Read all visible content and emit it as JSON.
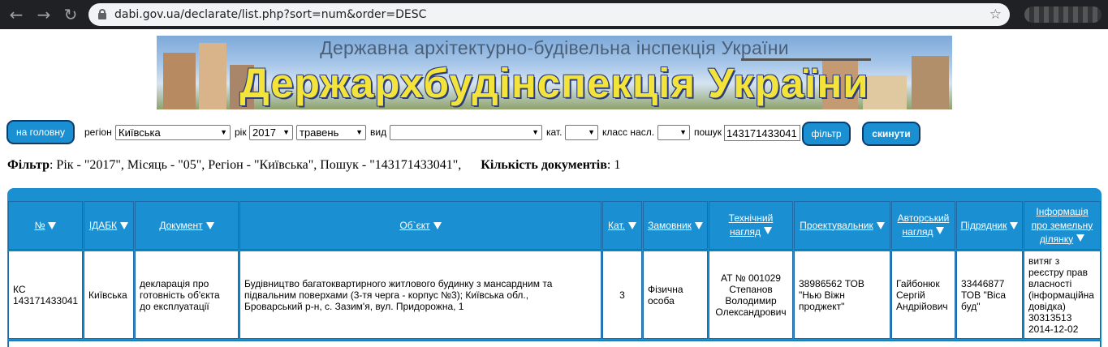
{
  "browser": {
    "url": "dabi.gov.ua/declarate/list.php?sort=num&order=DESC",
    "back_icon": "←",
    "forward_icon": "→",
    "reload_icon": "↻",
    "star_icon": "☆"
  },
  "banner": {
    "subtitle": "Державна архітектурно-будівельна інспекція України",
    "title": "Держархбудінспекція України"
  },
  "filters": {
    "home_button": "на головну",
    "region_label": "регіон",
    "region_value": "Київська",
    "year_label": "рік",
    "year_value": "2017",
    "month_value": "травень",
    "type_label": "вид",
    "type_value": "",
    "cat_label": "кат.",
    "cat_value": "",
    "class_label": "класс насл.",
    "class_value": "",
    "search_label": "пошук",
    "search_value": "143171433041",
    "filter_button": "фільтр",
    "reset_button": "скинути"
  },
  "summary": {
    "filter_label": "Фільтр",
    "filter_text": ": Рік - \"2017\", Місяць - \"05\", Регіон - \"Київська\", Пошук - \"143171433041\",",
    "count_label": "Кількість документів",
    "count_value": ": 1"
  },
  "table": {
    "headers": [
      {
        "line1": "№",
        "line2": ""
      },
      {
        "line1": "ІДАБК",
        "line2": ""
      },
      {
        "line1": "Документ",
        "line2": ""
      },
      {
        "line1": "Об`єкт",
        "line2": ""
      },
      {
        "line1": "Кат.",
        "line2": ""
      },
      {
        "line1": "Замовник",
        "line2": ""
      },
      {
        "line1": "Технічний",
        "line2": "нагляд"
      },
      {
        "line1": "Проектувальник",
        "line2": ""
      },
      {
        "line1": "Авторський",
        "line2": "нагляд"
      },
      {
        "line1": "Підрядник",
        "line2": ""
      },
      {
        "line1": "Інформація",
        "line2": "про земельну",
        "line3": "ділянку"
      }
    ],
    "row": {
      "num": [
        "КС",
        "143171433041"
      ],
      "idabk": [
        "Київська"
      ],
      "document": [
        "декларація про",
        "готовність об'єкта",
        "до експлуатації"
      ],
      "object": [
        "Будівництво багатоквартирного житлового будинку з мансардним та",
        "підвальним поверхами (3-тя черга - корпус №3); Київська обл.,",
        "Броварський р-н, с. Зазим'я, вул. Придорожна, 1"
      ],
      "cat": [
        "3"
      ],
      "customer": [
        "Фізична",
        "особа"
      ],
      "tech_supervision": [
        "АТ № 001029",
        "Степанов",
        "Володимир",
        "Олександрович"
      ],
      "designer": [
        "38986562 ТОВ",
        "\"Нью Віжн",
        "проджект\""
      ],
      "author_supervision": [
        "Гайбонюк",
        "Сергій",
        "Андрійович"
      ],
      "contractor": [
        "33446877",
        "ТОВ \"Віса",
        "буд\""
      ],
      "land_info": [
        "витяг з",
        "реєстру прав",
        "власності",
        "(інформаційна",
        "довідка)",
        "30313513",
        "2014-12-02"
      ]
    }
  }
}
